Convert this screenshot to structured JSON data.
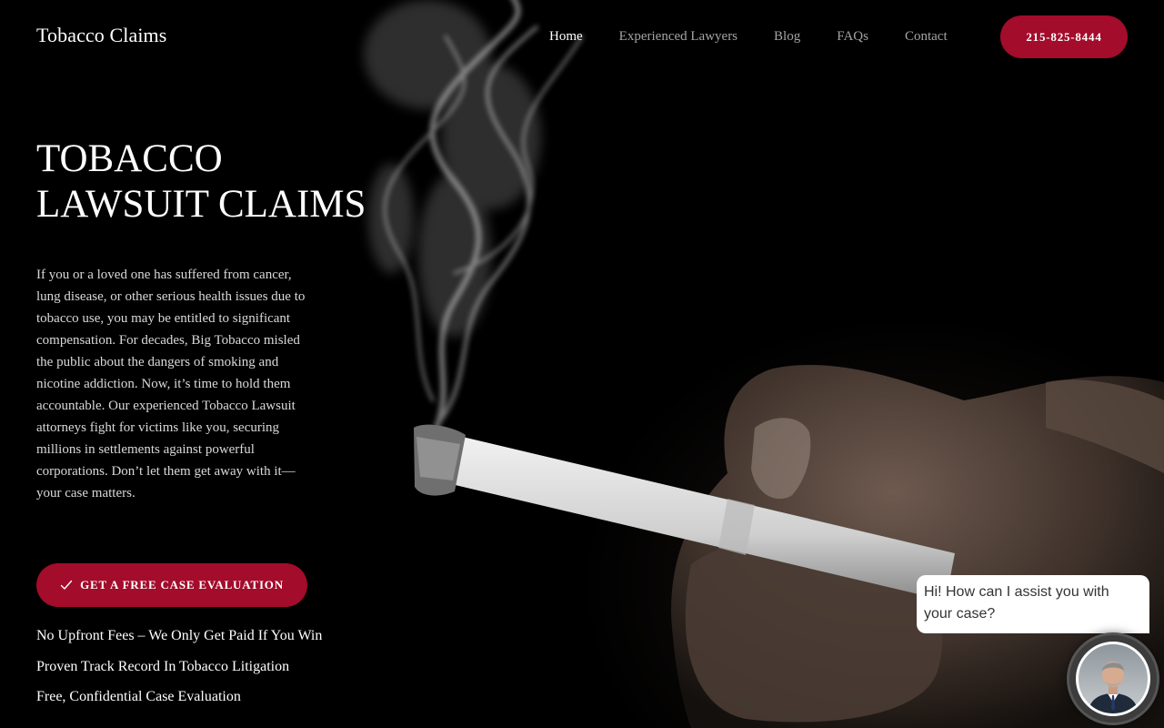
{
  "header": {
    "logo": "Tobacco Claims",
    "nav": [
      {
        "label": "Home",
        "active": true
      },
      {
        "label": "Experienced Lawyers",
        "active": false
      },
      {
        "label": "Blog",
        "active": false
      },
      {
        "label": "FAQs",
        "active": false
      },
      {
        "label": "Contact",
        "active": false
      }
    ],
    "phone": "215-825-8444"
  },
  "hero": {
    "title_line1": "TOBACCO",
    "title_line2": "LAWSUIT CLAIMS",
    "body": "If you or a loved one has suffered from cancer, lung disease, or other serious health issues due to tobacco use, you may be entitled to significant compensation. For decades, Big Tobacco misled the public about the dangers of smoking and nicotine addiction. Now, it’s time to hold them accountable. Our experienced Tobacco Lawsuit attorneys fight for victims like you, securing millions in settlements against powerful corporations. Don’t let them get away with it—your case matters.",
    "cta": "GET A FREE CASE EVALUATION",
    "benefits": [
      "No Upfront Fees – We Only Get Paid If You Win",
      "Proven Track Record In Tobacco Litigation",
      "Free, Confidential Case Evaluation"
    ]
  },
  "chat": {
    "message": "Hi! How can I assist you with your case?"
  },
  "colors": {
    "accent": "#a30c2b",
    "background": "#000000",
    "nav_inactive": "#a4a4a4"
  },
  "icons": {
    "cta": "check-icon",
    "chat": "avatar"
  }
}
